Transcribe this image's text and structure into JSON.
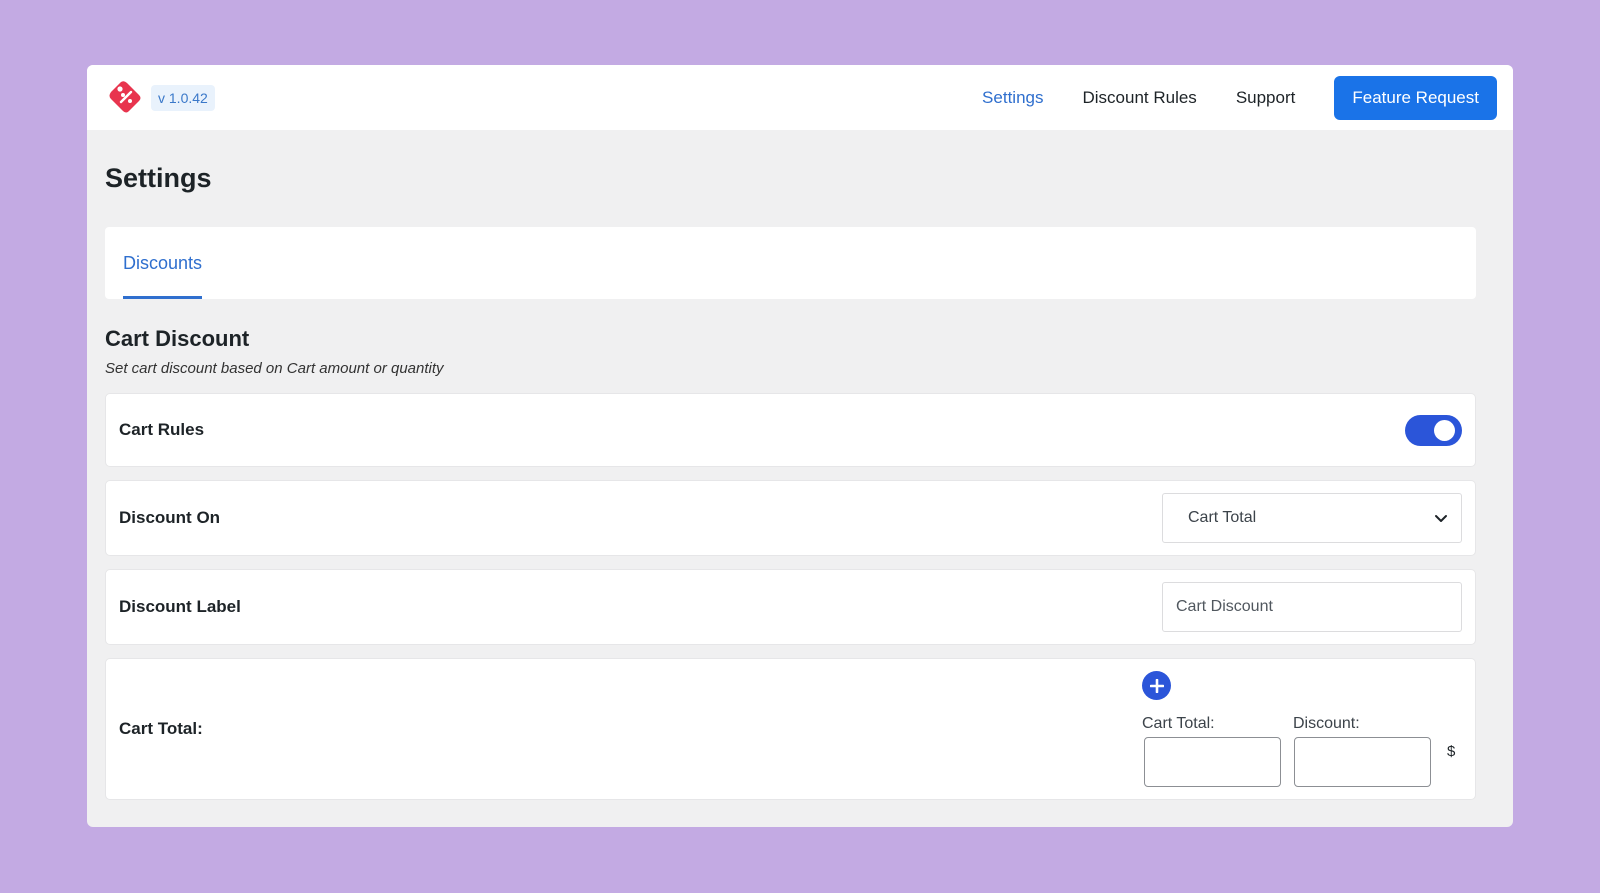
{
  "header": {
    "logo_icon": "price-tag-percent-icon",
    "version": "v 1.0.42",
    "nav": {
      "settings": "Settings",
      "discount_rules": "Discount Rules",
      "support": "Support",
      "feature_request": "Feature Request"
    }
  },
  "page": {
    "title": "Settings",
    "tabs": [
      {
        "label": "Discounts",
        "active": true
      }
    ]
  },
  "section": {
    "title": "Cart Discount",
    "description": "Set cart discount based on Cart amount or quantity"
  },
  "rows": {
    "cart_rules": {
      "label": "Cart Rules",
      "enabled": true
    },
    "discount_on": {
      "label": "Discount On",
      "selected": "Cart Total"
    },
    "discount_label": {
      "label": "Discount Label",
      "value": "",
      "placeholder": "Cart Discount"
    },
    "cart_total": {
      "label": "Cart Total:",
      "tier_cart_total_label": "Cart Total:",
      "tier_discount_label": "Discount:",
      "currency": "$"
    }
  },
  "colors": {
    "background": "#c3aae3",
    "primary_button": "#1a73e8",
    "active_link": "#2f6fce",
    "toggle_on": "#2b55d9",
    "logo": "#e8344e"
  }
}
